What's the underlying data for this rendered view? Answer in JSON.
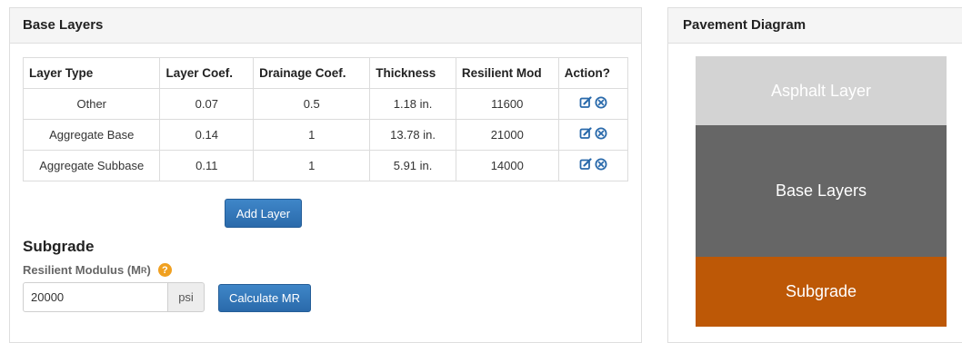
{
  "base_layers": {
    "title": "Base Layers",
    "columns": [
      "Layer Type",
      "Layer Coef.",
      "Drainage Coef.",
      "Thickness",
      "Resilient Mod",
      "Action?"
    ],
    "rows": [
      {
        "type": "Other",
        "coef": "0.07",
        "drain": "0.5",
        "thickness": "1.18 in.",
        "mod": "11600"
      },
      {
        "type": "Aggregate Base",
        "coef": "0.14",
        "drain": "1",
        "thickness": "13.78 in.",
        "mod": "21000"
      },
      {
        "type": "Aggregate Subbase",
        "coef": "0.11",
        "drain": "1",
        "thickness": "5.91 in.",
        "mod": "14000"
      }
    ],
    "action_icons": [
      "edit-icon",
      "remove-icon"
    ],
    "add_button": "Add Layer"
  },
  "subgrade": {
    "title": "Subgrade",
    "label_main": "Resilient Modulus (M",
    "label_sub": "R",
    "label_end": ")",
    "help_icon": "?",
    "value": "20000",
    "unit": "psi",
    "calc_button": "Calculate MR"
  },
  "diagram": {
    "title": "Pavement Diagram",
    "layers": [
      {
        "label": "Asphalt Layer",
        "color": "#d3d3d3"
      },
      {
        "label": "Base Layers",
        "color": "#666666"
      },
      {
        "label": "Subgrade",
        "color": "#bd5806"
      }
    ]
  },
  "colors": {
    "button": "#2e74b5",
    "icon": "#2a6aab",
    "help": "#f0a020"
  }
}
